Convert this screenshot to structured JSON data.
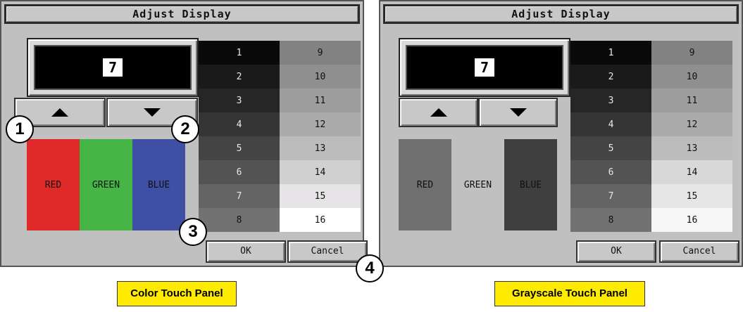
{
  "panels": [
    {
      "title": "Adjust Display",
      "display_value": "7",
      "swatches": [
        {
          "label": "RED",
          "color": "#e02a2a"
        },
        {
          "label": "GREEN",
          "color": "#45b545"
        },
        {
          "label": "BLUE",
          "color": "#3f4fa3"
        }
      ],
      "grid_colors": {
        "1": "#0a0a0a",
        "2": "#1a1a1a",
        "3": "#262626",
        "4": "#353535",
        "5": "#444444",
        "6": "#535353",
        "7": "#646464",
        "8": "#727272",
        "9": "#828282",
        "10": "#8f8f8f",
        "11": "#9e9e9e",
        "12": "#ababab",
        "13": "#bcbcbc",
        "14": "#d0d0d0",
        "15": "#e6e4e6",
        "16": "#ffffff"
      },
      "ok_label": "OK",
      "cancel_label": "Cancel",
      "caption": "Color Touch Panel"
    },
    {
      "title": "Adjust Display",
      "display_value": "7",
      "swatches": [
        {
          "label": "RED",
          "color": "#6f6f6f"
        },
        {
          "label": "GREEN",
          "color": "#c0c0c0"
        },
        {
          "label": "BLUE",
          "color": "#3f3f3f"
        }
      ],
      "grid_colors": {
        "1": "#0a0a0a",
        "2": "#1a1a1a",
        "3": "#262626",
        "4": "#353535",
        "5": "#444444",
        "6": "#535353",
        "7": "#646464",
        "8": "#727272",
        "9": "#828282",
        "10": "#8f8f8f",
        "11": "#9e9e9e",
        "12": "#ababab",
        "13": "#bcbcbc",
        "14": "#d8d8d8",
        "15": "#e6e6e6",
        "16": "#f6f6f6"
      },
      "ok_label": "OK",
      "cancel_label": "Cancel",
      "caption": "Grayscale Touch Panel"
    }
  ],
  "grid_numbers": [
    "1",
    "2",
    "3",
    "4",
    "5",
    "6",
    "7",
    "8",
    "9",
    "10",
    "11",
    "12",
    "13",
    "14",
    "15",
    "16"
  ],
  "callouts": [
    "1",
    "2",
    "3",
    "4"
  ]
}
